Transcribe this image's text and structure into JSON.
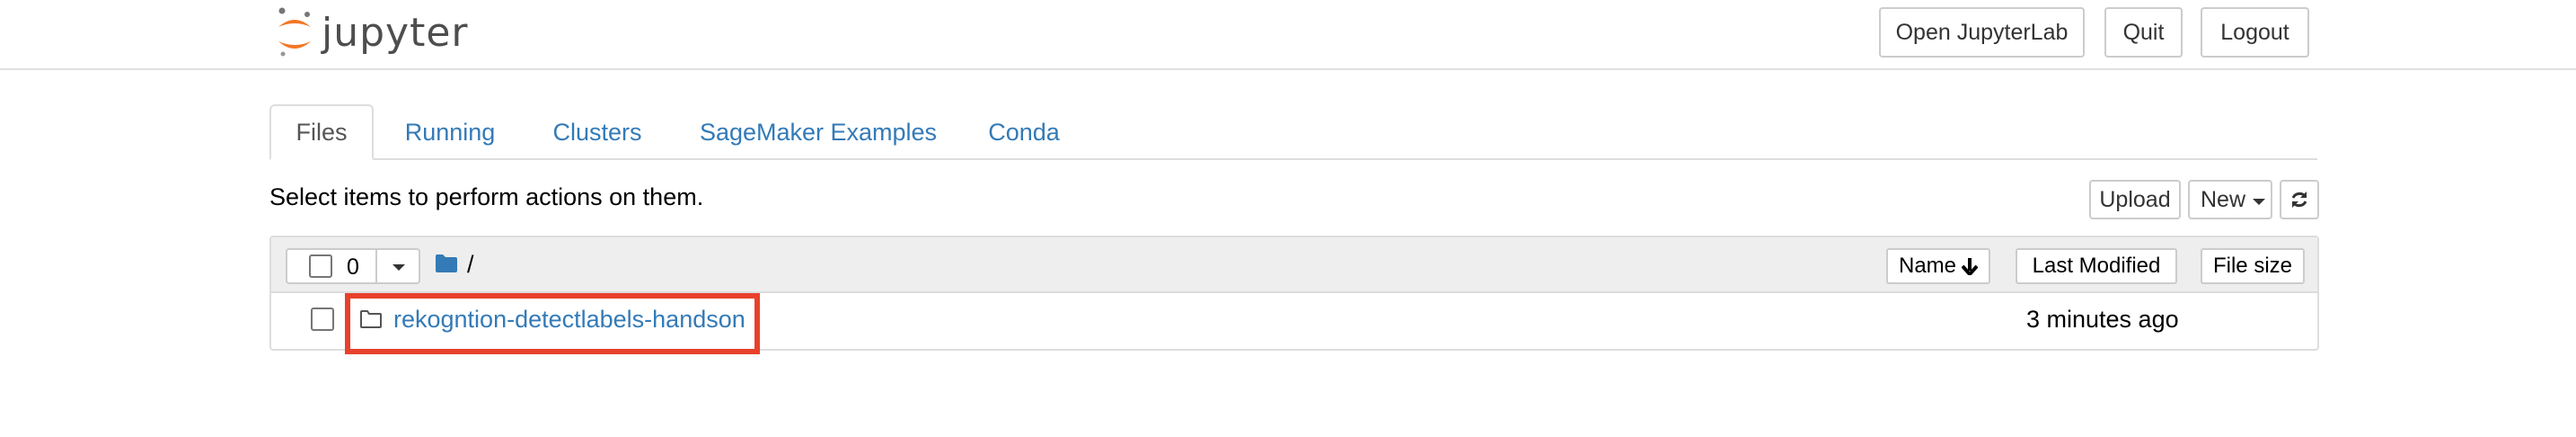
{
  "header": {
    "logo_text": "jupyter",
    "buttons": {
      "open_lab": "Open JupyterLab",
      "quit": "Quit",
      "logout": "Logout"
    }
  },
  "tabs": [
    {
      "label": "Files",
      "active": true
    },
    {
      "label": "Running",
      "active": false
    },
    {
      "label": "Clusters",
      "active": false
    },
    {
      "label": "SageMaker Examples",
      "active": false
    },
    {
      "label": "Conda",
      "active": false
    }
  ],
  "toolbar": {
    "hint": "Select items to perform actions on them.",
    "upload": "Upload",
    "new": "New"
  },
  "list": {
    "selected_count": "0",
    "breadcrumb": "/",
    "columns": {
      "name": "Name",
      "last_modified": "Last Modified",
      "file_size": "File size"
    },
    "rows": [
      {
        "name": "rekogntion-detectlabels-handson",
        "modified": "3 minutes ago",
        "type": "folder"
      }
    ]
  },
  "colors": {
    "link": "#337ab7",
    "highlight": "#e8412c",
    "logo_orange": "#f37726"
  },
  "icons": [
    "jupyter-logo-icon",
    "caret-down-icon",
    "folder-icon",
    "arrow-down-icon",
    "refresh-icon",
    "folder-outline-icon"
  ]
}
